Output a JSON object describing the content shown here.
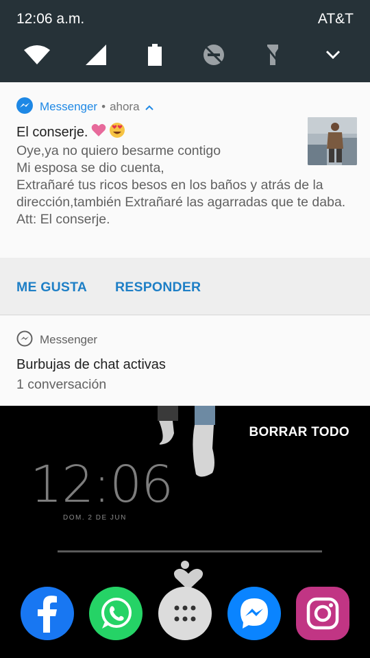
{
  "status_bar": {
    "time": "12:06 a.m.",
    "carrier": "AT&T"
  },
  "quick_settings": {
    "icons": [
      "wifi-icon",
      "cell-signal-icon",
      "battery-icon",
      "do-not-disturb-off-icon",
      "flashlight-off-icon",
      "chevron-down-icon"
    ]
  },
  "notification": {
    "app": "Messenger",
    "separator": "•",
    "time": "ahora",
    "title": "El conserje.",
    "title_emojis": [
      "pink-heart-emoji",
      "heart-eyes-emoji"
    ],
    "body": "Oye,ya no quiero besarme contigo\nMi esposa se dio cuenta,\nExtrañaré tus ricos besos en los baños y atrás de la dirección,también Extrañaré las agarradas que te daba.\nAtt: El conserje.",
    "actions": {
      "like": "ME GUSTA",
      "reply": "RESPONDER"
    }
  },
  "notification2": {
    "app": "Messenger",
    "title": "Burbujas de chat activas",
    "subtitle": "1 conversación"
  },
  "lockscreen": {
    "clear_all": "BORRAR TODO",
    "clock": "12:06",
    "date": "DOM. 2 DE JUN",
    "dock": [
      "facebook-icon",
      "whatsapp-icon",
      "app-drawer-icon",
      "messenger-icon",
      "instagram-icon"
    ]
  },
  "colors": {
    "accent": "#1e88e5",
    "header_bg": "#263238",
    "action_text": "#1e7fc6"
  }
}
